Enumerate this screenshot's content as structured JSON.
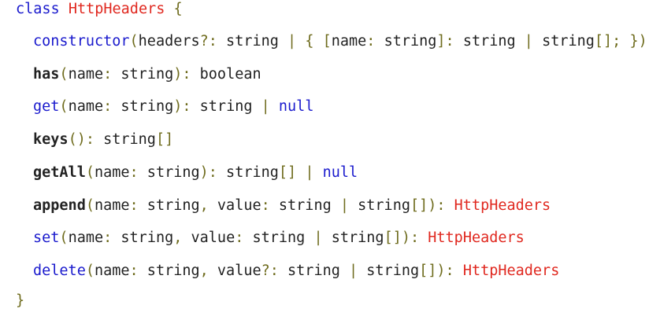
{
  "code": {
    "class_keyword": "class",
    "class_name": "HttpHeaders",
    "open_brace": "{",
    "close_brace": "}",
    "members": [
      {
        "name": "constructor",
        "params": "(headers?: string | { [name: string]: string | string[]; })",
        "returns": ""
      },
      {
        "name": "has",
        "params": "(name: string)",
        "returns": ": boolean"
      },
      {
        "name": "get",
        "params": "(name: string)",
        "returns": ": string | null"
      },
      {
        "name": "keys",
        "params": "()",
        "returns": ": string[]"
      },
      {
        "name": "getAll",
        "params": "(name: string)",
        "returns": ": string[] | null"
      },
      {
        "name": "append",
        "params": "(name: string, value: string | string[])",
        "returns": ": HttpHeaders"
      },
      {
        "name": "set",
        "params": "(name: string, value: string | string[])",
        "returns": ": HttpHeaders"
      },
      {
        "name": "delete",
        "params": "(name: string, value?: string | string[])",
        "returns": ": HttpHeaders"
      }
    ]
  }
}
